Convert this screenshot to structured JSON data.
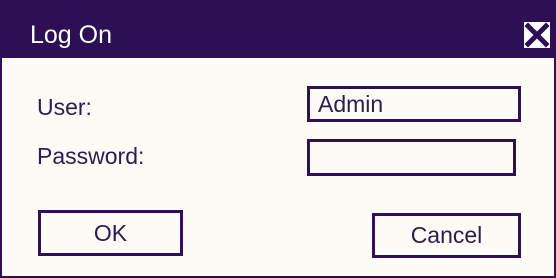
{
  "dialog": {
    "title": "Log On",
    "close_icon": "close-icon",
    "fields": {
      "user": {
        "label": "User:",
        "value": "Admin",
        "placeholder": ""
      },
      "password": {
        "label": "Password:",
        "value": "",
        "placeholder": ""
      }
    },
    "buttons": {
      "ok": "OK",
      "cancel": "Cancel"
    }
  },
  "colors": {
    "titlebar": "#2c0f54",
    "background": "#fcfbf6",
    "text": "#2d1c4f",
    "border": "#2f0f57"
  }
}
